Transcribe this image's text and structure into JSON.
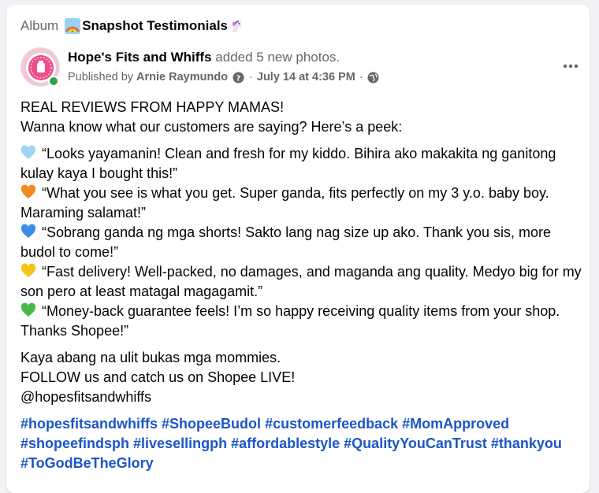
{
  "album": {
    "label": "Album",
    "name": "Snapshot Testimonials"
  },
  "post": {
    "page_name": "Hope's Fits and Whiffs",
    "action_text": "added 5 new photos.",
    "published_by_label": "Published by",
    "publisher": "Arnie Raymundo",
    "date": "July 14 at 4:36 PM",
    "audience_icon": "globe-icon",
    "more_icon": "more-horizontal-icon"
  },
  "content": {
    "intro": [
      "REAL REVIEWS FROM HAPPY MAMAS!",
      "Wanna know what our customers are saying? Here’s a peek:"
    ],
    "reviews": [
      {
        "heart": "light-blue-heart",
        "color": "#9ed4f0",
        "text": "“Looks yayamanin! Clean and fresh for my kiddo. Bihira ako makakita ng ganitong kulay kaya I bought this!”"
      },
      {
        "heart": "orange-heart",
        "color": "#f08a24",
        "text": "“What you see is what you get. Super ganda, fits perfectly on my 3 y.o. baby boy. Maraming salamat!”"
      },
      {
        "heart": "blue-heart",
        "color": "#3b8ee6",
        "text": "“Sobrang ganda ng mga shorts! Sakto lang nag size up ako. Thank you sis, more budol to come!”"
      },
      {
        "heart": "yellow-heart",
        "color": "#f5c518",
        "text": "“Fast delivery! Well-packed, no damages, and maganda ang quality. Medyo big for my son pero at least matagal magagamit.”"
      },
      {
        "heart": "green-heart",
        "color": "#4cb848",
        "text": "“Money-back guarantee feels! I’m so happy receiving quality items from your shop. Thanks Shopee!”"
      }
    ],
    "outro": [
      "Kaya abang na ulit bukas mga mommies.",
      "FOLLOW us and catch us on Shopee LIVE!",
      "@hopesfitsandwhiffs"
    ],
    "hashtags": [
      "#hopesfitsandwhiffs",
      "#ShopeeBudol",
      "#customerfeedback",
      "#MomApproved",
      "#shopeefindsph",
      "#livesellingph",
      "#affordablestyle",
      "#QualityYouCanTrust",
      "#thankyou",
      "#ToGodBeTheGlory"
    ]
  },
  "colors": {
    "hashtag": "#1b56c8",
    "secondary_text": "#65676b",
    "online": "#31a24c"
  }
}
